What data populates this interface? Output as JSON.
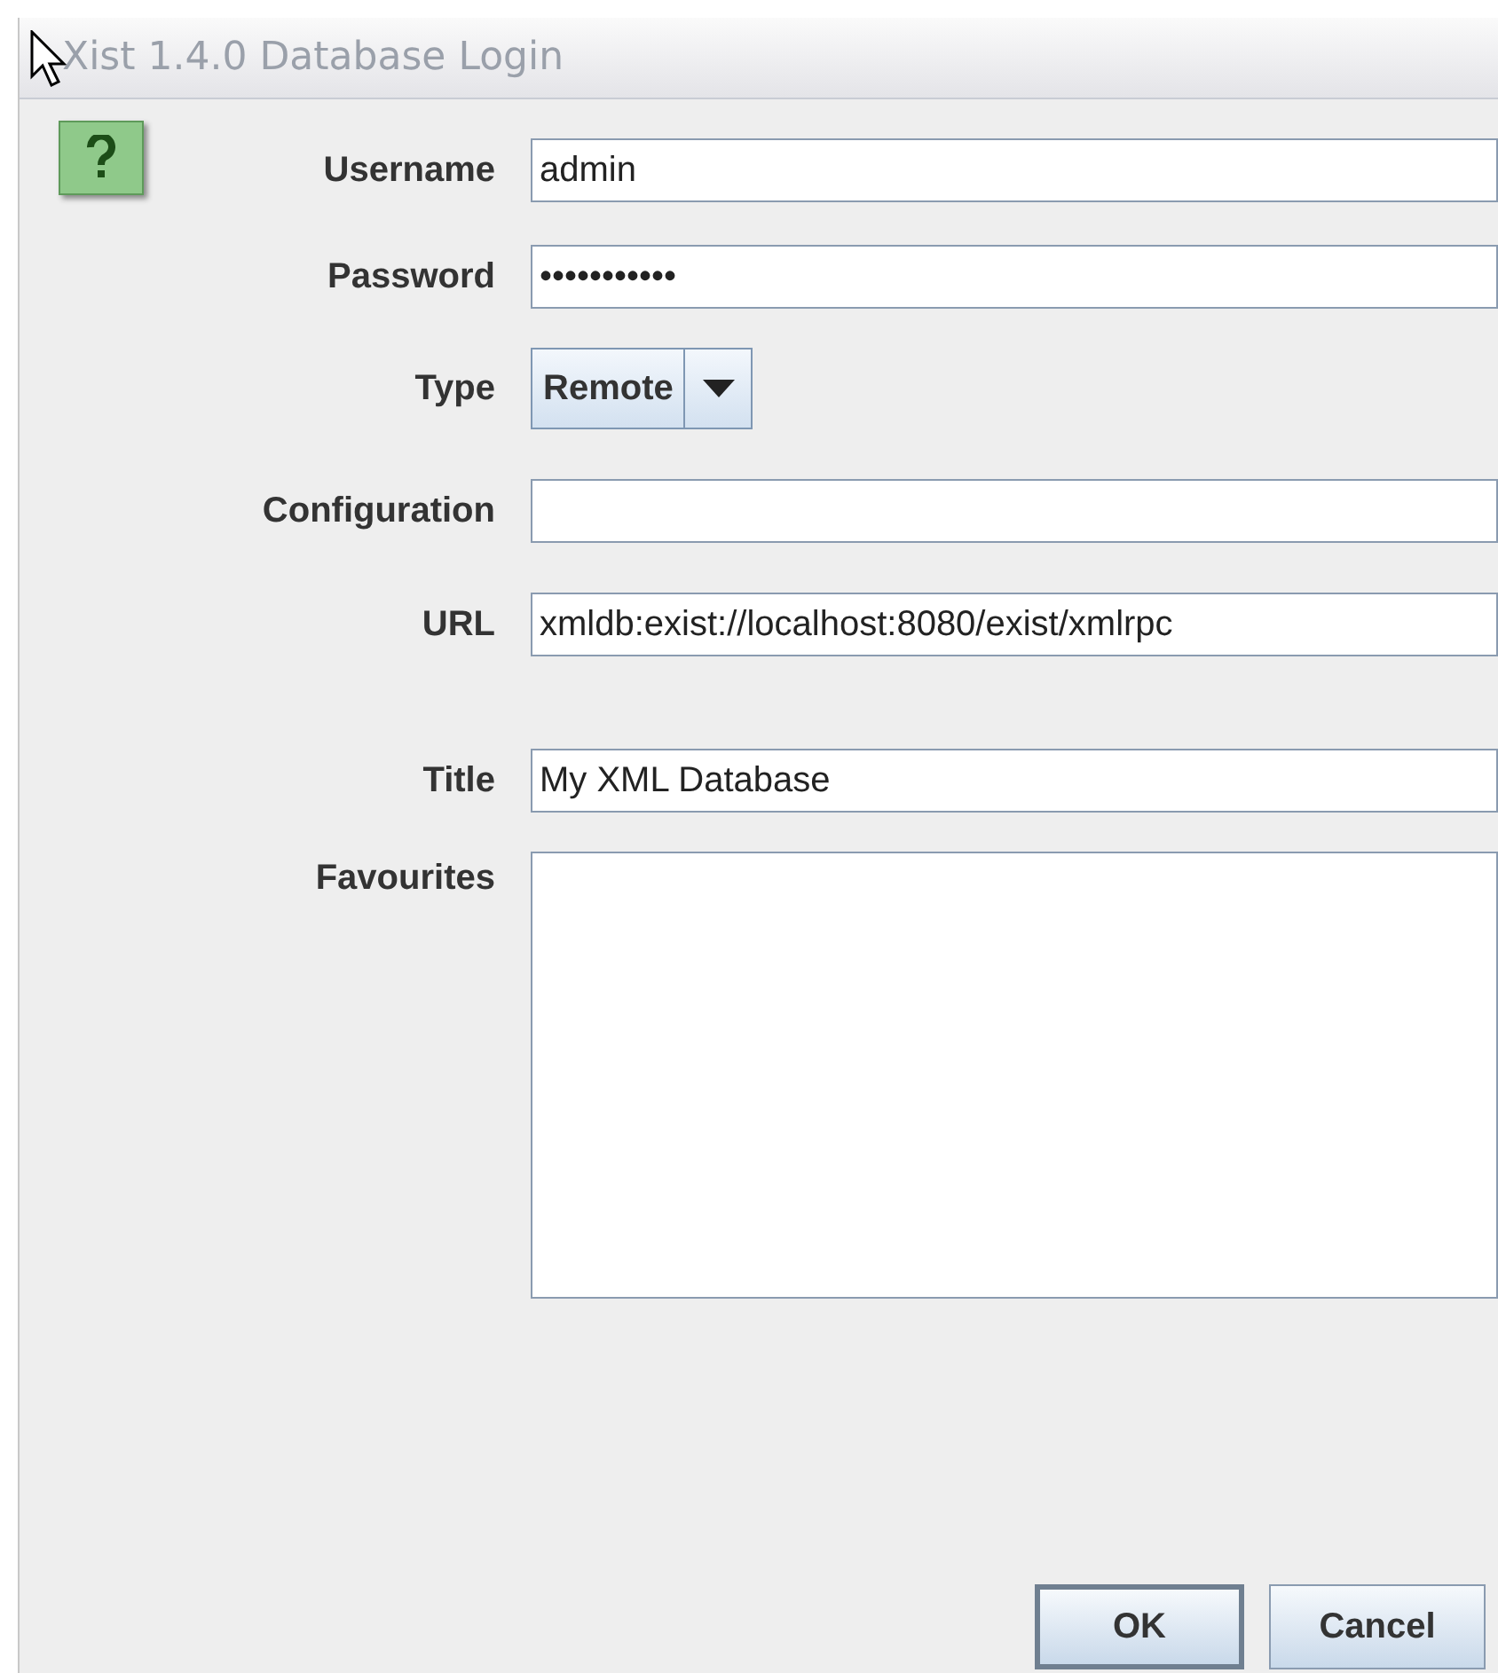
{
  "window": {
    "title": "Xist 1.4.0 Database Login"
  },
  "fields": [
    {
      "kind": "text",
      "label": "Username",
      "value": "admin"
    },
    {
      "kind": "text",
      "label": "Password",
      "value": "•••••••••••"
    },
    {
      "kind": "combo",
      "label": "Type",
      "value": "Remote"
    },
    {
      "kind": "text",
      "label": "Configuration"
    },
    {
      "kind": "text",
      "label": "URL",
      "value": "xmldb:exist://localhost:8080/exist/xmlrpc"
    },
    {
      "kind": "text",
      "label": "Title",
      "value": "My XML Database"
    },
    {
      "kind": "area",
      "label": "Favourites"
    }
  ],
  "buttons": [
    {
      "label": "OK",
      "default": true
    },
    {
      "label": "Cancel",
      "default": false
    }
  ]
}
